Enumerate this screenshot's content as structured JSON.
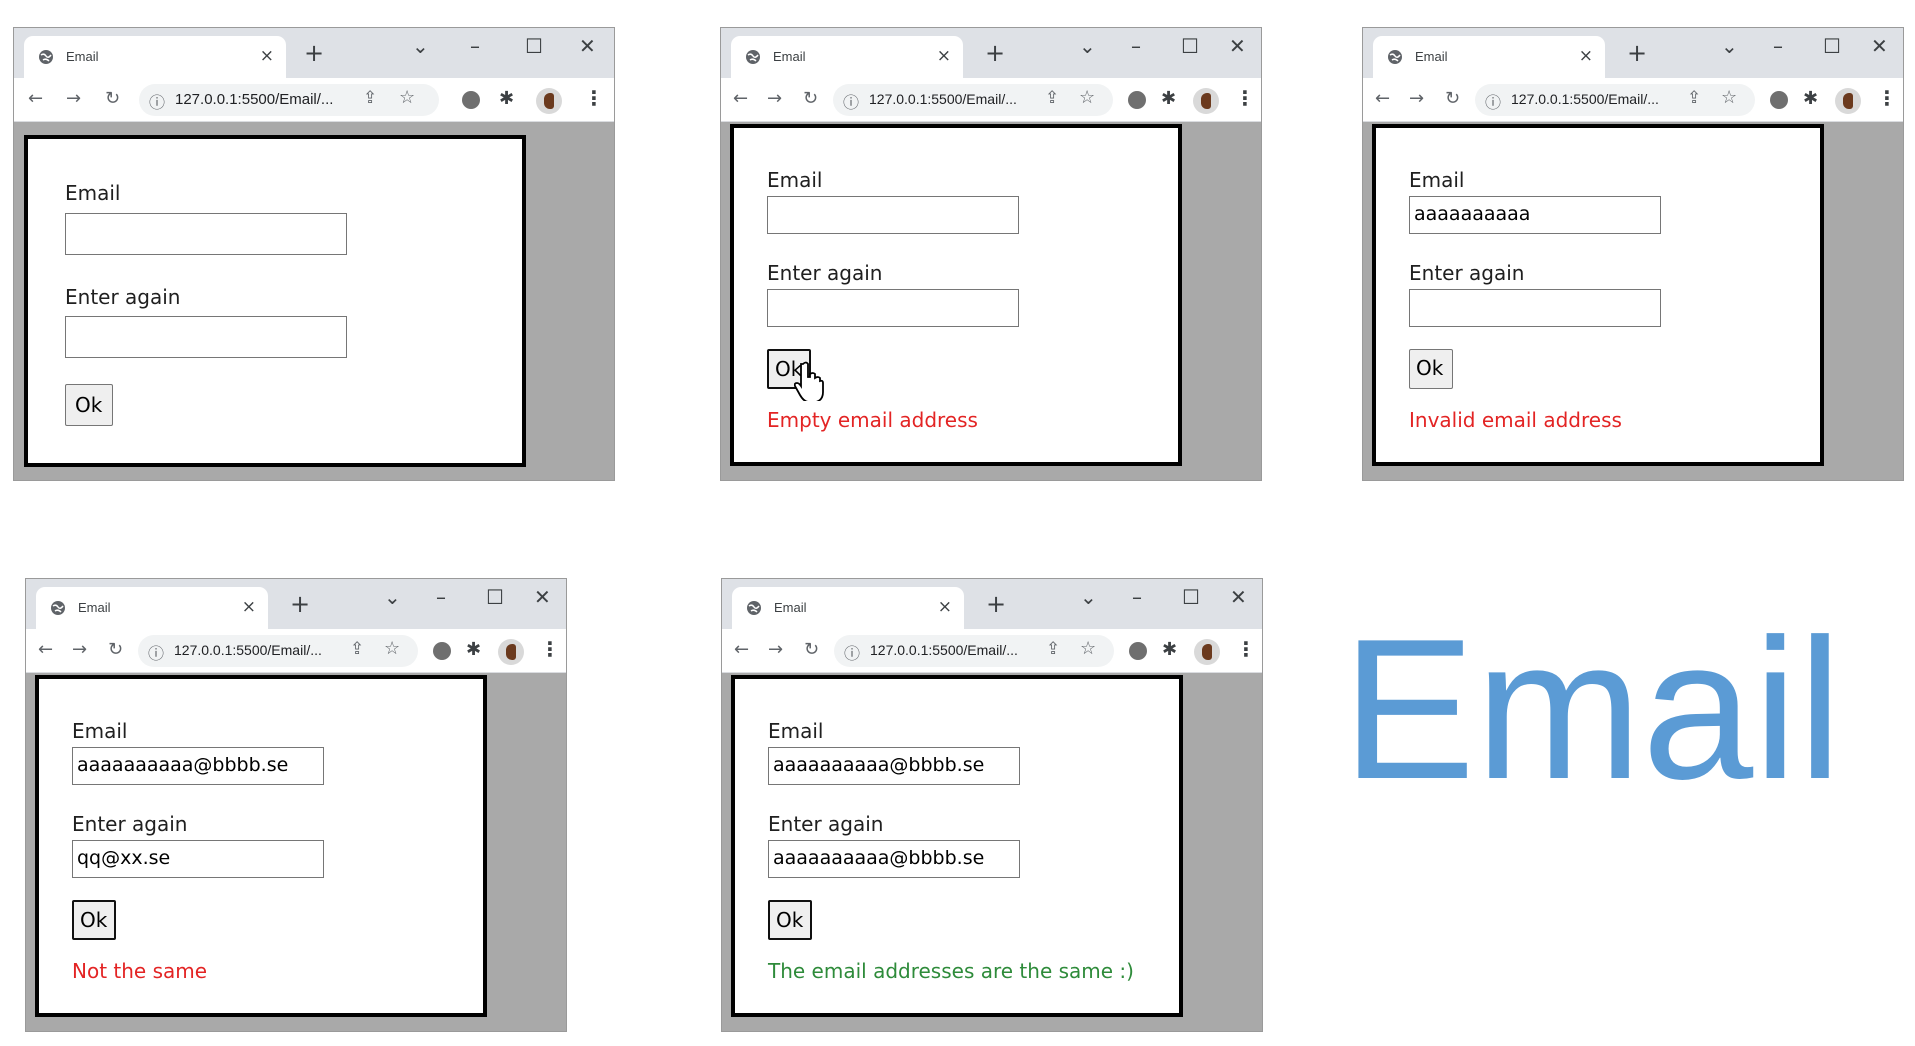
{
  "heading": {
    "text": "Email",
    "color": "#5b9bd5"
  },
  "colors": {
    "error": "#e32424",
    "success": "#2e8b3a"
  },
  "browser": {
    "tab_title": "Email",
    "url": "127.0.0.1:5500/Email/...",
    "icons": [
      "globe-icon",
      "close-icon",
      "plus-icon",
      "chevron-down-icon",
      "minimize-icon",
      "maximize-icon",
      "back-icon",
      "forward-icon",
      "reload-icon",
      "info-icon",
      "share-icon",
      "star-icon",
      "extension-icon",
      "puzzle-icon",
      "profile-avatar",
      "kebab-menu-icon"
    ]
  },
  "screens": [
    {
      "email_label": "Email",
      "email_value": "",
      "again_label": "Enter again",
      "again_value": "",
      "ok_label": "Ok",
      "message": ""
    },
    {
      "email_label": "Email",
      "email_value": "",
      "again_label": "Enter again",
      "again_value": "",
      "ok_label": "Ok",
      "message": "Empty email address"
    },
    {
      "email_label": "Email",
      "email_value": "aaaaaaaaaa",
      "again_label": "Enter again",
      "again_value": "",
      "ok_label": "Ok",
      "message": "Invalid email address"
    },
    {
      "email_label": "Email",
      "email_value": "aaaaaaaaaa@bbbb.se",
      "again_label": "Enter again",
      "again_value": "qq@xx.se",
      "ok_label": "Ok",
      "message": "Not the same"
    },
    {
      "email_label": "Email",
      "email_value": "aaaaaaaaaa@bbbb.se",
      "again_label": "Enter again",
      "again_value": "aaaaaaaaaa@bbbb.se",
      "ok_label": "Ok",
      "message": "The email addresses are the same :)"
    }
  ]
}
